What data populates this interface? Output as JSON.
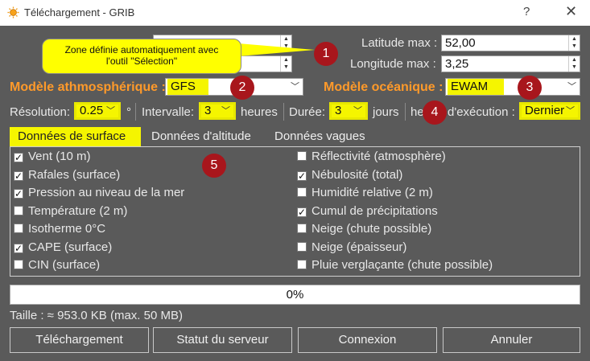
{
  "window": {
    "title": "Téléchargement - GRIB",
    "help": "?",
    "close": "✕"
  },
  "coords": {
    "lat_min_value": "",
    "lon_min_value": "",
    "lat_max_label": "Latitude max :",
    "lat_max_value": "52,00",
    "lon_max_label": "Longitude max :",
    "lon_max_value": "3,25"
  },
  "callout": {
    "line1": "Zone définie automatiquement avec",
    "line2": "l'outil \"Sélection\""
  },
  "models": {
    "atmo_label": "Modèle athmosphérique :",
    "atmo_value": "GFS",
    "ocean_label": "Modèle océanique :",
    "ocean_value": "EWAM"
  },
  "params": {
    "resolution_label": "Résolution:",
    "resolution_value": "0.25",
    "resolution_unit": "°",
    "interval_label": "Intervalle:",
    "interval_value": "3",
    "interval_unit": "heures",
    "duration_label": "Durée:",
    "duration_value": "3",
    "duration_unit": "jours",
    "run_label_a": "he",
    "run_label_b": "d'exécution :",
    "run_value": "Dernier"
  },
  "markers": [
    "1",
    "2",
    "3",
    "4",
    "5"
  ],
  "tabs": [
    "Données de surface",
    "Données d'altitude",
    "Données vagues"
  ],
  "checkboxes_left": [
    {
      "label": "Vent (10 m)",
      "checked": true
    },
    {
      "label": "Rafales (surface)",
      "checked": true
    },
    {
      "label": "Pression au niveau de la mer",
      "checked": true
    },
    {
      "label": "Température (2 m)",
      "checked": false
    },
    {
      "label": "Isotherme 0°C",
      "checked": false
    },
    {
      "label": "CAPE (surface)",
      "checked": true
    },
    {
      "label": "CIN (surface)",
      "checked": false
    }
  ],
  "checkboxes_right": [
    {
      "label": "Réflectivité (atmosphère)",
      "checked": false
    },
    {
      "label": "Nébulosité (total)",
      "checked": true
    },
    {
      "label": "Humidité relative (2 m)",
      "checked": false
    },
    {
      "label": "Cumul de précipitations",
      "checked": true
    },
    {
      "label": "Neige (chute possible)",
      "checked": false
    },
    {
      "label": "Neige (épaisseur)",
      "checked": false
    },
    {
      "label": "Pluie verglaçante (chute possible)",
      "checked": false
    }
  ],
  "progress": {
    "text": "0%",
    "fraction": 0
  },
  "size_text": "Taille : ≈ 953.0 KB (max. 50 MB)",
  "buttons": {
    "download": "Téléchargement",
    "server_status": "Statut du serveur",
    "connect": "Connexion",
    "cancel": "Annuler"
  }
}
